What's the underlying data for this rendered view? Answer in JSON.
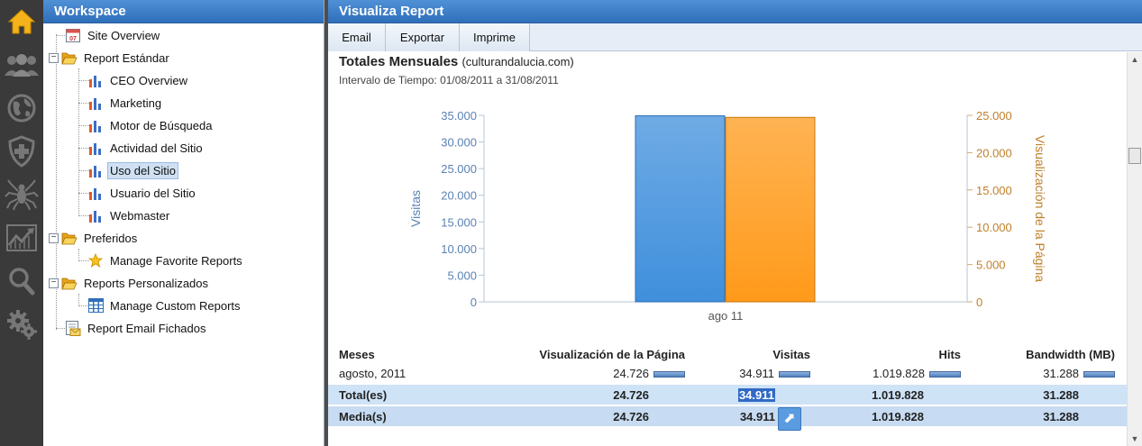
{
  "workspace": {
    "title": "Workspace",
    "tree": [
      {
        "label": "Site Overview",
        "icon": "calendar-icon",
        "level": 1,
        "day": "07"
      },
      {
        "label": "Report Estándar",
        "icon": "folder-open-icon",
        "level": 0,
        "expanded": true
      },
      {
        "label": "CEO Overview",
        "icon": "bar-chart-icon",
        "level": 2
      },
      {
        "label": "Marketing",
        "icon": "bar-chart-icon",
        "level": 2
      },
      {
        "label": "Motor de Búsqueda",
        "icon": "bar-chart-icon",
        "level": 2
      },
      {
        "label": "Actividad del Sitio",
        "icon": "bar-chart-icon",
        "level": 2
      },
      {
        "label": "Uso del Sitio",
        "icon": "bar-chart-icon",
        "level": 2,
        "selected": true
      },
      {
        "label": "Usuario del Sitio",
        "icon": "bar-chart-icon",
        "level": 2
      },
      {
        "label": "Webmaster",
        "icon": "bar-chart-icon",
        "level": 2
      },
      {
        "label": "Preferidos",
        "icon": "folder-open-icon",
        "level": 0,
        "expanded": true
      },
      {
        "label": "Manage Favorite Reports",
        "icon": "star-icon",
        "level": 2
      },
      {
        "label": "Reports Personalizados",
        "icon": "folder-open-icon",
        "level": 0,
        "expanded": true
      },
      {
        "label": "Manage Custom Reports",
        "icon": "grid-icon",
        "level": 2
      },
      {
        "label": "Report Email Fichados",
        "icon": "email-report-icon",
        "level": 1
      }
    ]
  },
  "rail": {
    "icons": [
      "home-icon",
      "users-icon",
      "globe-icon",
      "shield-plus-icon",
      "spider-icon",
      "trend-chart-icon",
      "search-icon",
      "gears-icon"
    ]
  },
  "main": {
    "title": "Visualiza Report",
    "toolbar": [
      {
        "label": "Email",
        "name": "email-button"
      },
      {
        "label": "Exportar",
        "name": "exportar-button"
      },
      {
        "label": "Imprime",
        "name": "imprime-button"
      }
    ],
    "report_title": "Totales Mensuales",
    "report_site": "(culturandalucia.com)",
    "interval_label": "Intervalo de Tiempo:",
    "interval_value": "01/08/2011 a 31/08/2011"
  },
  "chart_data": {
    "type": "bar",
    "categories": [
      "ago 11"
    ],
    "series": [
      {
        "name": "Visitas",
        "axis": "left",
        "color": "#3f8fdc",
        "values": [
          34911
        ]
      },
      {
        "name": "Visualización de la Página",
        "axis": "right",
        "color": "#ff9a1a",
        "values": [
          24726
        ]
      }
    ],
    "ylabel": "Visitas",
    "ylabel_right": "Visualización de la Página",
    "ylim": [
      0,
      35000
    ],
    "ylim_right": [
      0,
      25000
    ],
    "yticks": [
      "0",
      "5.000",
      "10.000",
      "15.000",
      "20.000",
      "25.000",
      "30.000",
      "35.000"
    ],
    "yticks_right": [
      "0",
      "5.000",
      "10.000",
      "15.000",
      "20.000",
      "25.000"
    ],
    "left_axis_color": "#5a82b4",
    "right_axis_color": "#c0802a",
    "grid": false
  },
  "table": {
    "headers": [
      "Meses",
      "Visualización de la Página",
      "Visitas",
      "Hits",
      "Bandwidth (MB)"
    ],
    "rows": [
      {
        "label": "agosto, 2011",
        "pageviews": "24.726",
        "visits": "34.911",
        "hits": "1.019.828",
        "bandwidth": "31.288"
      }
    ],
    "total": {
      "label": "Total(es)",
      "pageviews": "24.726",
      "visits": "34.911",
      "hits": "1.019.828",
      "bandwidth": "31.288"
    },
    "media": {
      "label": "Media(s)",
      "pageviews": "24.726",
      "visits": "34.911",
      "hits": "1.019.828",
      "bandwidth": "31.288"
    }
  }
}
